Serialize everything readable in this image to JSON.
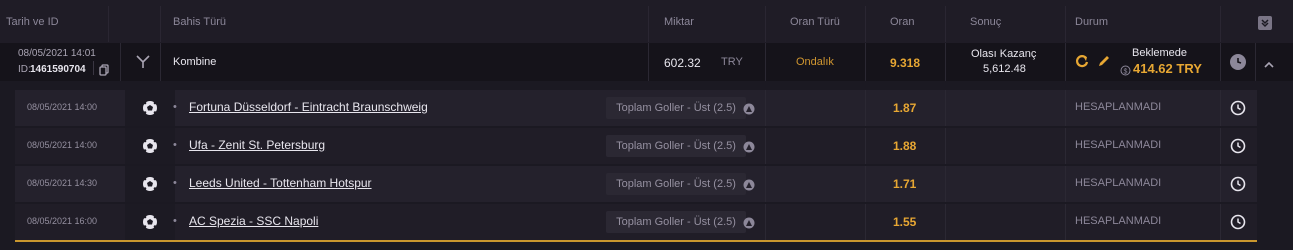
{
  "header": {
    "date_id": "Tarih ve ID",
    "bet_type": "Bahis Türü",
    "amount": "Miktar",
    "odds_type": "Oran Türü",
    "odds": "Oran",
    "result": "Sonuç",
    "status": "Durum"
  },
  "bet": {
    "date": "08/05/2021 14:01",
    "id_label": "ID:",
    "id": "1461590704",
    "type": "Kombine",
    "amount": "602.32",
    "currency": "TRY",
    "odds_type": "Ondalık",
    "odds": "9.318",
    "potential_label": "Olası Kazanç",
    "potential_value": "5,612.48",
    "status": "Beklemede",
    "cashout": "414.62 TRY"
  },
  "legs": [
    {
      "date": "08/05/2021 14:00",
      "match": "Fortuna Düsseldorf - Eintracht Braunschweig",
      "market": "Toplam Goller - Üst (2.5)",
      "odds": "1.87",
      "status": "HESAPLANMADI"
    },
    {
      "date": "08/05/2021 14:00",
      "match": "Ufa - Zenit St. Petersburg",
      "market": "Toplam Goller - Üst (2.5)",
      "odds": "1.88",
      "status": "HESAPLANMADI"
    },
    {
      "date": "08/05/2021 14:30",
      "match": "Leeds United - Tottenham Hotspur",
      "market": "Toplam Goller - Üst (2.5)",
      "odds": "1.71",
      "status": "HESAPLANMADI"
    },
    {
      "date": "08/05/2021 16:00",
      "match": "AC Spezia - SSC Napoli",
      "market": "Toplam Goller - Üst (2.5)",
      "odds": "1.55",
      "status": "HESAPLANMADI"
    }
  ],
  "icons": {
    "expand_all": "double-chevron-down-icon",
    "bet_type": "combo-branch-icon",
    "copy": "copy-icon",
    "cashout": "refresh-icon",
    "edit": "pencil-icon",
    "history": "clock-icon",
    "collapse": "chevron-up-icon",
    "sport": "soccer-ball-icon",
    "stats": "stats-icon"
  },
  "colors": {
    "accent": "#e7a733",
    "background": "#1b1922",
    "header": "#1f1c26"
  }
}
